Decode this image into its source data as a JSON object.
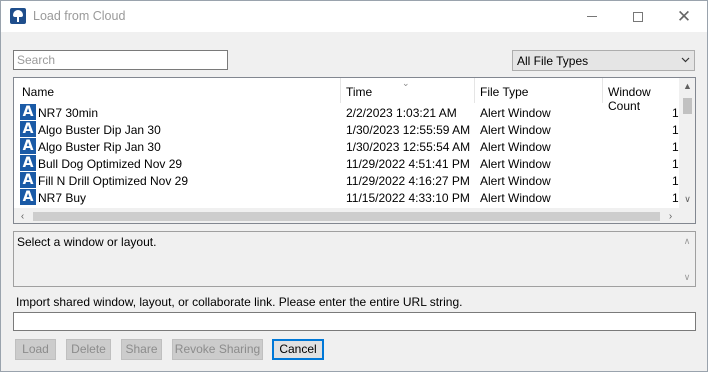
{
  "window": {
    "title": "Load from Cloud",
    "minimize_glyph": "minimize",
    "maximize_glyph": "maximize",
    "close_glyph": "✕"
  },
  "search": {
    "placeholder": "Search",
    "value": ""
  },
  "filter": {
    "selected": "All File Types"
  },
  "list": {
    "columns": [
      "Name",
      "Time",
      "File Type",
      "Window Count"
    ],
    "sorted_column": "Time",
    "rows": [
      {
        "name": "NR7 30min",
        "time": "2/2/2023 1:03:21 AM",
        "type": "Alert Window",
        "count": "1"
      },
      {
        "name": "Algo Buster Dip Jan 30",
        "time": "1/30/2023 12:55:59 AM",
        "type": "Alert Window",
        "count": "1"
      },
      {
        "name": "Algo Buster Rip Jan 30",
        "time": "1/30/2023 12:55:54 AM",
        "type": "Alert Window",
        "count": "1"
      },
      {
        "name": "Bull Dog Optimized Nov 29",
        "time": "11/29/2022 4:51:41 PM",
        "type": "Alert Window",
        "count": "1"
      },
      {
        "name": "Fill N Drill Optimized Nov 29",
        "time": "11/29/2022 4:16:27 PM",
        "type": "Alert Window",
        "count": "1"
      },
      {
        "name": "NR7 Buy",
        "time": "11/15/2022 4:33:10 PM",
        "type": "Alert Window",
        "count": "1"
      }
    ],
    "row_icon_letter": "A"
  },
  "message": {
    "text": "Select a window or layout."
  },
  "import": {
    "label": "Import shared window, layout, or collaborate link. Please enter the entire URL string.",
    "value": ""
  },
  "buttons": {
    "load": "Load",
    "delete": "Delete",
    "share": "Share",
    "revoke": "Revoke Sharing",
    "cancel": "Cancel"
  },
  "colors": {
    "row_icon": "#1a5aa6",
    "cancel_border": "#0078d7"
  }
}
